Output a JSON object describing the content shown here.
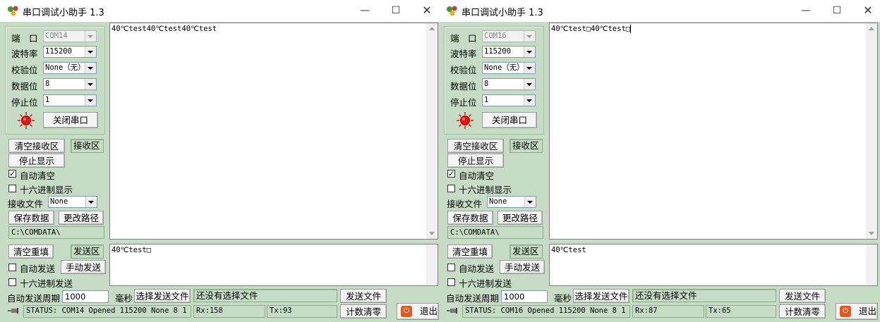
{
  "windows": [
    {
      "title": "串口调试小助手 1.3",
      "controls": {
        "minimize": "—",
        "maximize": "☐",
        "close": "✕"
      },
      "settings": {
        "port_label": "端　口",
        "port_value": "COM14",
        "baud_label": "波特率",
        "baud_value": "115200",
        "parity_label": "校验位",
        "parity_value": "None（无）",
        "databits_label": "数据位",
        "databits_value": "8",
        "stopbits_label": "停止位",
        "stopbits_value": "1",
        "close_port_label": "关闭串口"
      },
      "receive": {
        "clear_label": "清空接收区",
        "area_label": "接收区",
        "stop_display_label": "停止显示",
        "auto_clear_label": "自动清空",
        "auto_clear_checked": true,
        "hex_display_label": "十六进制显示",
        "hex_display_checked": false,
        "file_label": "接收文件",
        "file_value": "None",
        "save_label": "保存数据",
        "change_path_label": "更改路径",
        "path_value": "C:\\COMDATA\\",
        "content": "40℃test40℃test40℃test"
      },
      "send": {
        "clear_label": "清空重填",
        "area_label": "发送区",
        "auto_send_label": "自动发送",
        "auto_send_checked": false,
        "manual_send_label": "手动发送",
        "hex_send_label": "十六进制发送",
        "hex_send_checked": false,
        "content": "40℃test□"
      },
      "bottom": {
        "period_label": "自动发送周期",
        "period_value": "1000",
        "ms_label": "毫秒",
        "choose_file_label": "选择发送文件",
        "file_status": "还没有选择文件",
        "send_file_label": "发送文件",
        "reset_count_label": "计数清零",
        "exit_label": "退出"
      },
      "status": {
        "text": "STATUS: COM14 Opened 115200 None  8 1",
        "rx": "Rx:158",
        "tx": "Tx:93"
      }
    },
    {
      "title": "串口调试小助手 1.3",
      "controls": {
        "minimize": "—",
        "maximize": "☐",
        "close": "✕"
      },
      "settings": {
        "port_label": "端　口",
        "port_value": "COM16",
        "baud_label": "波特率",
        "baud_value": "115200",
        "parity_label": "校验位",
        "parity_value": "None（无）",
        "databits_label": "数据位",
        "databits_value": "8",
        "stopbits_label": "停止位",
        "stopbits_value": "1",
        "close_port_label": "关闭串口"
      },
      "receive": {
        "clear_label": "清空接收区",
        "area_label": "接收区",
        "stop_display_label": "停止显示",
        "auto_clear_label": "自动清空",
        "auto_clear_checked": true,
        "hex_display_label": "十六进制显示",
        "hex_display_checked": false,
        "file_label": "接收文件",
        "file_value": "None",
        "save_label": "保存数据",
        "change_path_label": "更改路径",
        "path_value": "C:\\COMDATA\\",
        "content": "40℃test□40℃test□"
      },
      "send": {
        "clear_label": "清空重填",
        "area_label": "发送区",
        "auto_send_label": "自动发送",
        "auto_send_checked": false,
        "manual_send_label": "手动发送",
        "hex_send_label": "十六进制发送",
        "hex_send_checked": false,
        "content": "40℃test"
      },
      "bottom": {
        "period_label": "自动发送周期",
        "period_value": "1000",
        "ms_label": "毫秒",
        "choose_file_label": "选择发送文件",
        "file_status": "还没有选择文件",
        "send_file_label": "发送文件",
        "reset_count_label": "计数清零",
        "exit_label": "退出"
      },
      "status": {
        "text": "STATUS: COM16 Opened 115200 None  8 1",
        "rx": "Rx:87",
        "tx": "Tx:65"
      }
    }
  ]
}
